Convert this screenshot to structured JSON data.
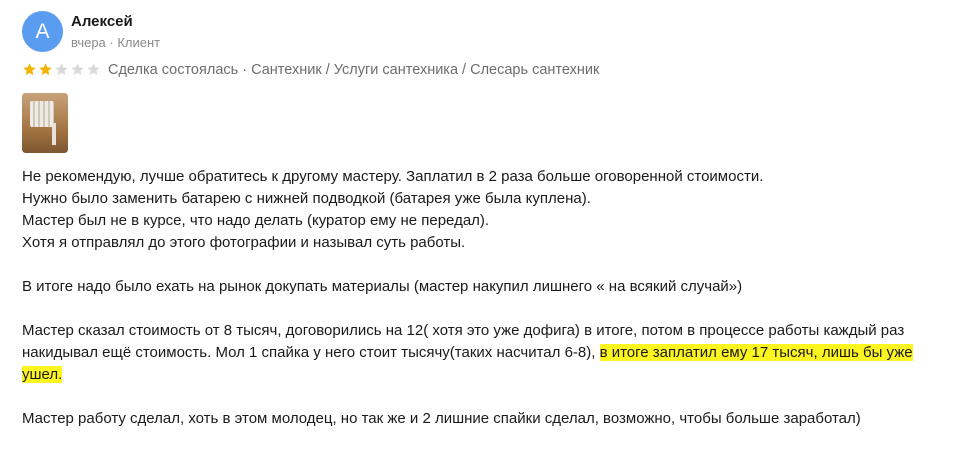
{
  "author": {
    "avatar_letter": "А",
    "avatar_color": "#5a9cf0",
    "name": "Алексей",
    "meta": "вчера · Клиент"
  },
  "rating": {
    "value": 2,
    "max": 5,
    "filled_color": "#f5b400",
    "empty_color": "#d9d9d9"
  },
  "deal_info": "Сделка состоялась · Сантехник / Услуги сантехника / Слесарь сантехник",
  "photo": {
    "icon": "radiator-photo-thumbnail"
  },
  "review": {
    "p1": [
      "Не рекомендую, лучше обратитесь к другому мастеру. Заплатил в 2 раза больше оговоренной стоимости.",
      "Нужно было заменить батарею с нижней подводкой (батарея уже была куплена).",
      "Мастер был не в курсе, что надо делать (куратор ему не передал).",
      "Хотя я отправлял до этого фотографии и называл суть работы."
    ],
    "p2": "В итоге надо было ехать на рынок докупать материалы (мастер накупил лишнего « на всякий случай»)",
    "p3_line1": "Мастер сказал стоимость от 8 тысяч, договорились на 12( хотя это уже дофига) в итоге, потом в процессе работы каждый раз",
    "p3_line2_plain": "накидывал ещё стоимость. Мол 1 спайка у него стоит тысячу(таких насчитал 6-8), ",
    "p3_highlight_a": "в итоге заплатил ему 17 тысяч, лишь бы уже",
    "p3_highlight_b": "ушел.",
    "highlight_color": "#fdf51f",
    "p4": "Мастер работу сделал, хоть в этом молодец, но так же и 2 лишние спайки сделал, возможно, чтобы больше заработал)"
  }
}
